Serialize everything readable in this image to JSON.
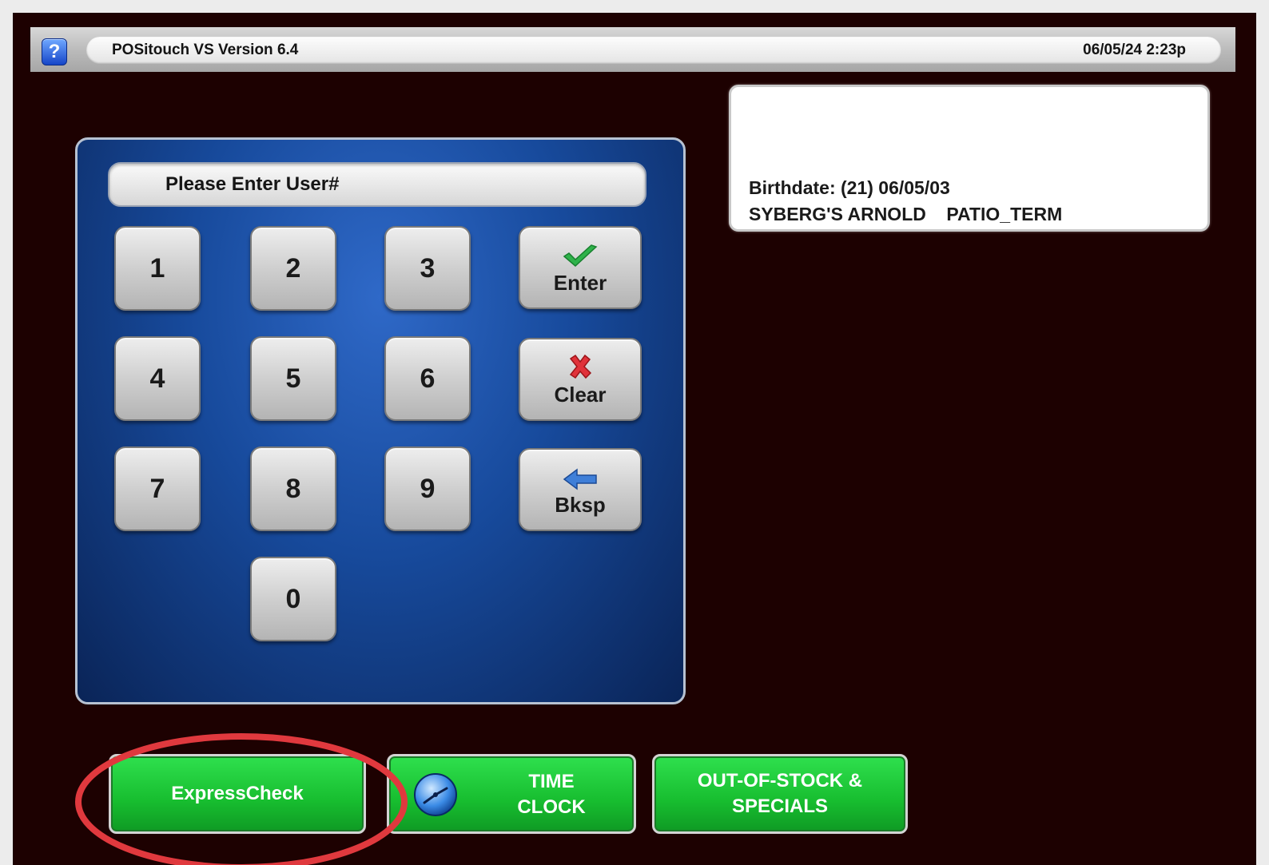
{
  "header": {
    "help_label": "?",
    "app_title": "POSitouch VS Version 6.4",
    "datetime": "06/05/24  2:23p"
  },
  "info_box": {
    "line1": "Birthdate: (21) 06/05/03",
    "line2": "SYBERG'S ARNOLD    PATIO_TERM"
  },
  "keypad": {
    "prompt": "Please Enter User#",
    "digits": [
      "1",
      "2",
      "3",
      "4",
      "5",
      "6",
      "7",
      "8",
      "9",
      "0"
    ],
    "enter_label": "Enter",
    "clear_label": "Clear",
    "bksp_label": "Bksp"
  },
  "bottom_buttons": {
    "express_label": "ExpressCheck",
    "timeclock_line1": "TIME",
    "timeclock_line2": "CLOCK",
    "outofstock_line1": "OUT-OF-STOCK &",
    "outofstock_line2": "SPECIALS"
  },
  "icons": {
    "help": "question-icon",
    "enter": "checkmark-icon",
    "clear": "x-icon",
    "bksp": "arrow-left-icon",
    "timeclock": "clock-icon"
  },
  "colors": {
    "background": "#1d0101",
    "panel_blue": "#174a9c",
    "button_green": "#17bd2f",
    "highlight_red": "#e0393e"
  }
}
